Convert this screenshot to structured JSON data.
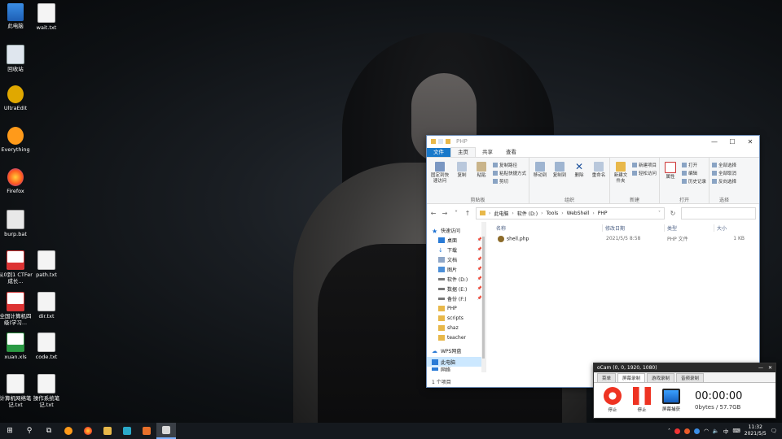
{
  "desktop": {
    "icons": [
      {
        "label": "此电脑",
        "icon": "computer-icon"
      },
      {
        "label": "wait.txt",
        "icon": "text-file-icon"
      },
      {
        "label": "回收站",
        "icon": "recycle-bin-icon"
      },
      {
        "label": "UltraEdit",
        "icon": "ultraedit-icon"
      },
      {
        "label": "Everything",
        "icon": "everything-search-icon"
      },
      {
        "label": "Firefox",
        "icon": "firefox-icon"
      },
      {
        "label": "burp.bat",
        "icon": "batch-file-icon"
      },
      {
        "label": "从0到1 CTFer成长...",
        "icon": "pdf-icon"
      },
      {
        "label": "path.txt",
        "icon": "text-file-icon"
      },
      {
        "label": "全国计算机四级(学习...",
        "icon": "pdf-icon"
      },
      {
        "label": "dir.txt",
        "icon": "text-file-icon"
      },
      {
        "label": "xuan.xls",
        "icon": "spreadsheet-icon"
      },
      {
        "label": "code.txt",
        "icon": "text-file-icon"
      },
      {
        "label": "计算机网络笔记.txt",
        "icon": "text-file-icon"
      },
      {
        "label": "操作系统笔记.txt",
        "icon": "text-file-icon"
      }
    ]
  },
  "explorer": {
    "title": "PHP",
    "tabs": [
      "文件",
      "主页",
      "共享",
      "查看"
    ],
    "ribbon": {
      "clipboard": {
        "pin": "固定到快速访问",
        "copy": "复制",
        "paste": "粘贴",
        "copy_path": "复制路径",
        "paste_shortcut": "粘贴快捷方式",
        "cut": "剪切",
        "group": "剪贴板"
      },
      "organize": {
        "move_to": "移动到",
        "copy_to": "复制到",
        "delete": "删除",
        "rename": "重命名",
        "group": "组织"
      },
      "new": {
        "new_folder": "新建文件夹",
        "new_item": "新建项目",
        "easy_access": "轻松访问",
        "group": "新建"
      },
      "open": {
        "properties": "属性",
        "open": "打开",
        "edit": "编辑",
        "history": "历史记录",
        "group": "打开"
      },
      "select": {
        "select_all": "全部选择",
        "select_none": "全部取消",
        "invert": "反向选择",
        "group": "选择"
      }
    },
    "address": [
      "此电脑",
      "软件 (D:)",
      "Tools",
      "WebShell",
      "PHP"
    ],
    "nav": {
      "quick_access": "快速访问",
      "items": [
        {
          "label": "桌面",
          "pinned": true
        },
        {
          "label": "下载",
          "pinned": true
        },
        {
          "label": "文档",
          "pinned": true
        },
        {
          "label": "图片",
          "pinned": true
        },
        {
          "label": "软件 (D:)",
          "pinned": true
        },
        {
          "label": "数据 (E:)",
          "pinned": true
        },
        {
          "label": "备份 (F:)",
          "pinned": true
        },
        {
          "label": "PHP",
          "pinned": false
        },
        {
          "label": "scripts",
          "pinned": false
        },
        {
          "label": "shaz",
          "pinned": false
        },
        {
          "label": "teacher",
          "pinned": false
        }
      ],
      "wps": "WPS网盘",
      "this_pc": "此电脑",
      "network": "网络"
    },
    "columns": {
      "name": "名称",
      "date": "修改日期",
      "type": "类型",
      "size": "大小"
    },
    "files": [
      {
        "name": "shell.php",
        "date": "2021/5/5 8:58",
        "type": "PHP 文件",
        "size": "1 KB"
      }
    ],
    "status": "1 个项目"
  },
  "ocam": {
    "title": "oCam (0, 0, 1920, 1080)",
    "tabs": [
      "菜单",
      "屏幕录制",
      "游戏录制",
      "音频录制"
    ],
    "buttons": {
      "stop": "停止",
      "pause": "停止",
      "screen": "屏幕捕获"
    },
    "timer": "00:00:00",
    "storage": "0bytes / 57.7GB"
  },
  "taskbar": {
    "ime": "中",
    "time": "11:32",
    "date": "2021/5/5"
  }
}
